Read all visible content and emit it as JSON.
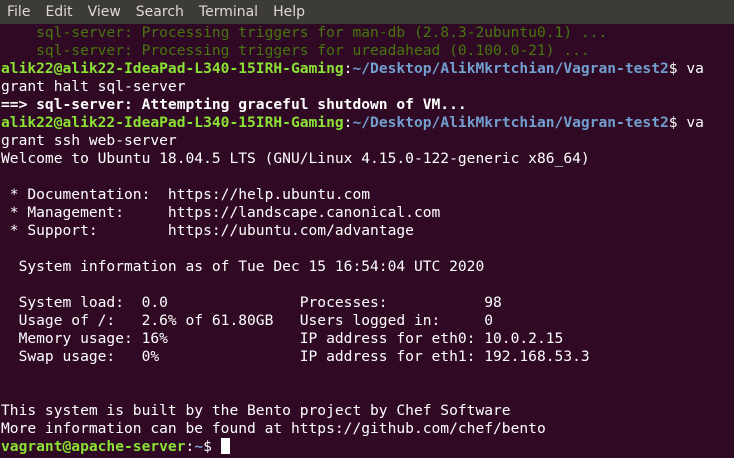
{
  "menu": [
    "File",
    "Edit",
    "View",
    "Search",
    "Terminal",
    "Help"
  ],
  "terminal": {
    "lines": [
      {
        "type": "muted",
        "text": "    sql-server: Processing triggers for man-db (2.8.3-2ubuntu0.1) ..."
      },
      {
        "type": "muted",
        "text": "    sql-server: Processing triggers for ureadahead (0.100.0-21) ..."
      },
      {
        "type": "prompt",
        "user": "alik22@alik22-IdeaPad-L340-15IRH-Gaming",
        "sep": ":",
        "path": "~/Desktop/AlikMkrtchian/Vagran-test2",
        "dollar": "$ ",
        "cmd": "va"
      },
      {
        "type": "plain",
        "text": "grant halt sql-server"
      },
      {
        "type": "bold",
        "text": "==> sql-server: Attempting graceful shutdown of VM..."
      },
      {
        "type": "prompt",
        "user": "alik22@alik22-IdeaPad-L340-15IRH-Gaming",
        "sep": ":",
        "path": "~/Desktop/AlikMkrtchian/Vagran-test2",
        "dollar": "$ ",
        "cmd": "va"
      },
      {
        "type": "plain",
        "text": "grant ssh web-server"
      },
      {
        "type": "plain",
        "text": "Welcome to Ubuntu 18.04.5 LTS (GNU/Linux 4.15.0-122-generic x86_64)"
      },
      {
        "type": "plain",
        "text": ""
      },
      {
        "type": "plain",
        "text": " * Documentation:  https://help.ubuntu.com"
      },
      {
        "type": "plain",
        "text": " * Management:     https://landscape.canonical.com"
      },
      {
        "type": "plain",
        "text": " * Support:        https://ubuntu.com/advantage"
      },
      {
        "type": "plain",
        "text": ""
      },
      {
        "type": "plain",
        "text": "  System information as of Tue Dec 15 16:54:04 UTC 2020"
      },
      {
        "type": "plain",
        "text": ""
      },
      {
        "type": "plain",
        "text": "  System load:  0.0               Processes:           98"
      },
      {
        "type": "plain",
        "text": "  Usage of /:   2.6% of 61.80GB   Users logged in:     0"
      },
      {
        "type": "plain",
        "text": "  Memory usage: 16%               IP address for eth0: 10.0.2.15"
      },
      {
        "type": "plain",
        "text": "  Swap usage:   0%                IP address for eth1: 192.168.53.3"
      },
      {
        "type": "plain",
        "text": ""
      },
      {
        "type": "plain",
        "text": ""
      },
      {
        "type": "plain",
        "text": "This system is built by the Bento project by Chef Software"
      },
      {
        "type": "plain",
        "text": "More information can be found at https://github.com/chef/bento"
      },
      {
        "type": "prompt",
        "user": "vagrant@apache-server",
        "sep": ":",
        "path": "~",
        "dollar": "$ ",
        "cmd": "",
        "cursor": true
      }
    ]
  },
  "colors": {
    "background": "#300a24",
    "menubar": "#3c3b37",
    "user": "#8ae234",
    "path": "#729fcf",
    "muted": "#4e9a06"
  }
}
